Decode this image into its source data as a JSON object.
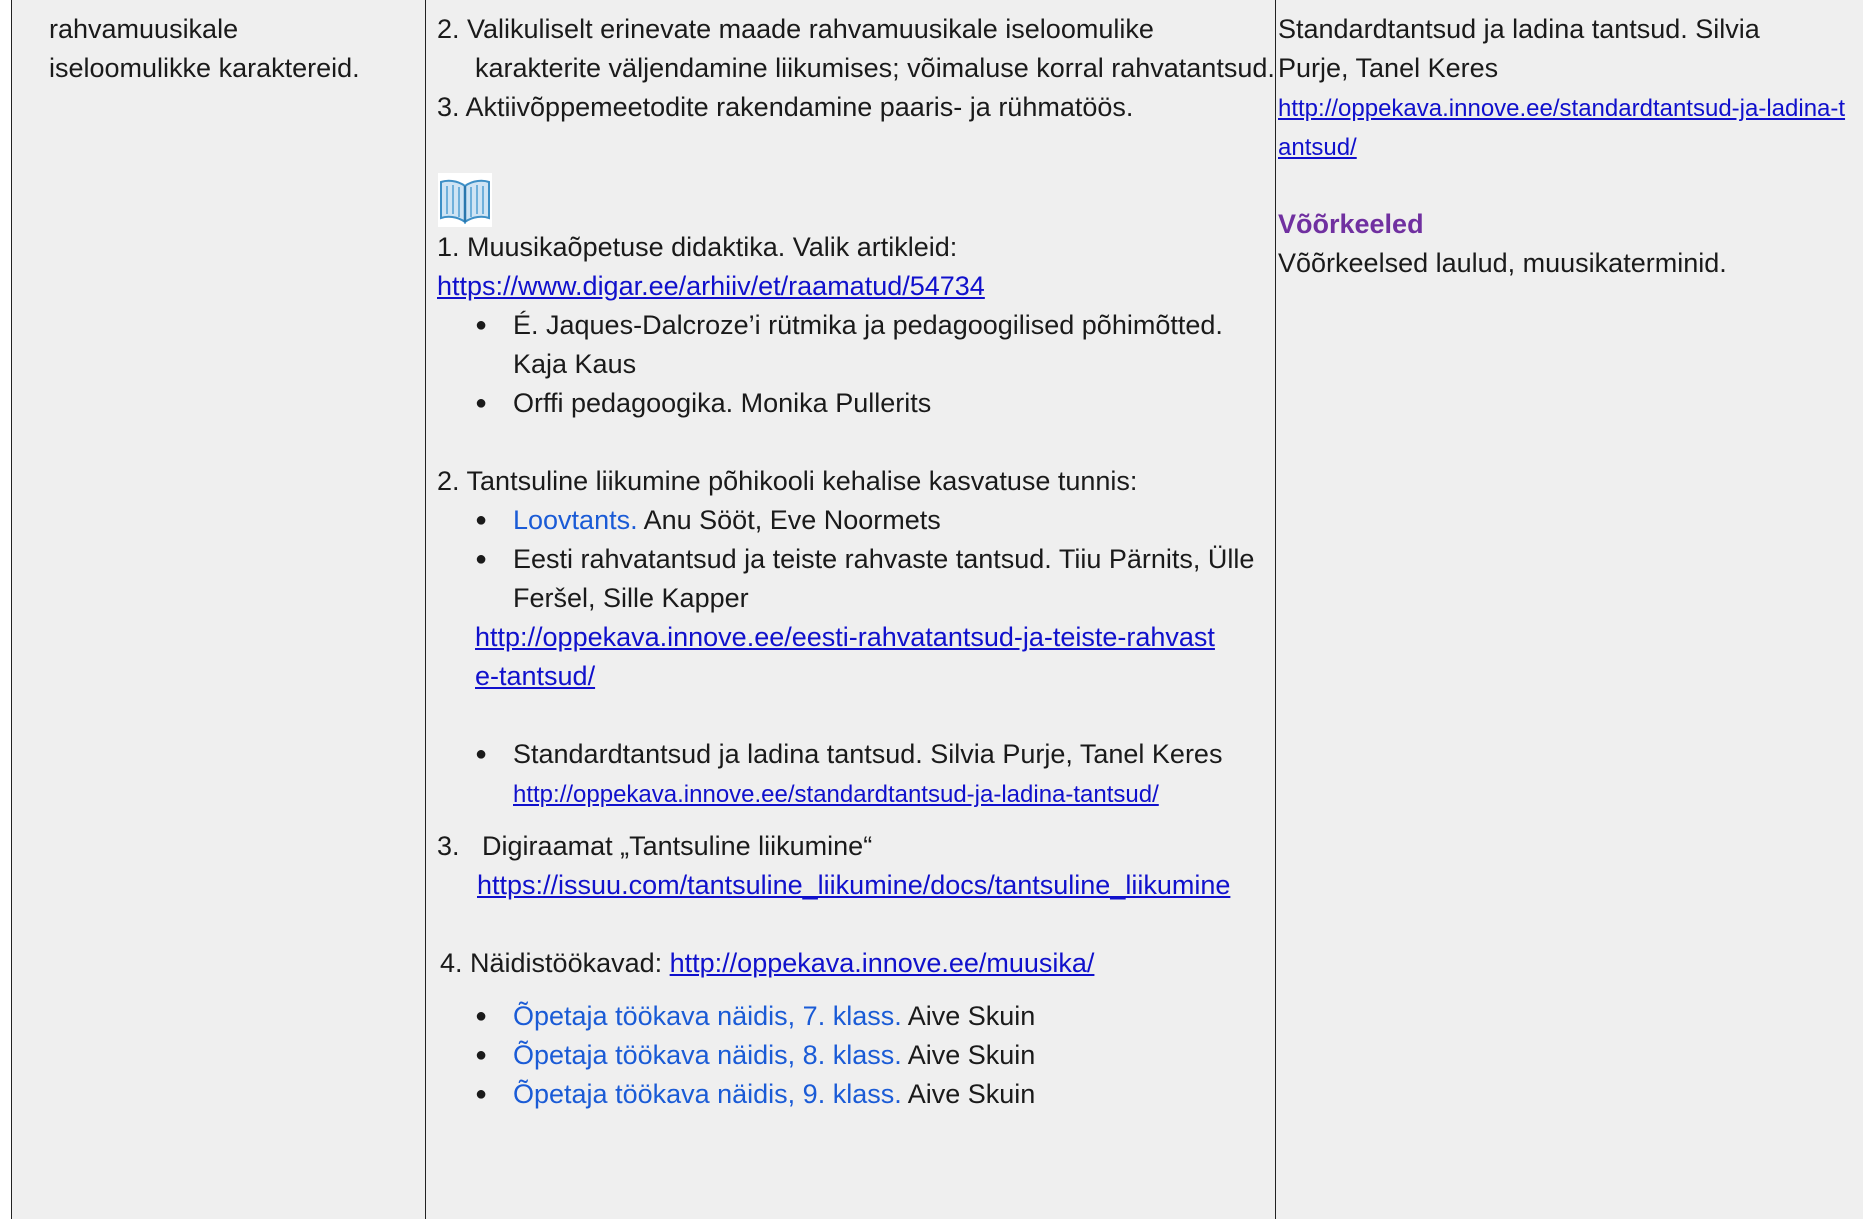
{
  "col1": {
    "lines": [
      "rahvamuusikale",
      "iseloomulikke karaktereid."
    ]
  },
  "col2": {
    "item2": "2. Valikuliselt erinevate maade rahvamuusikale iseloomulike karakterite väljendamine liikumises; võimaluse korral rahvatantsud.",
    "item3": "3. Aktiivõppemeetodite rakendamine paaris- ja rühmatöös.",
    "book_icon": "open-book-icon",
    "ref1": {
      "title": "1. Muusikaõpetuse didaktika. Valik artikleid:",
      "link": "https://www.digar.ee/arhiiv/et/raamatud/54734",
      "bullets": [
        "É. Jaques-Dalcroze’i rütmika ja pedagoogilised põhimõtted. Kaja Kaus",
        "Orffi pedagoogika. Monika Pullerits"
      ]
    },
    "ref2": {
      "title": "2. Tantsuline liikumine põhikooli kehalise kasvatuse tunnis:",
      "b1_link": "Loovtants.",
      "b1_rest": " Anu Sööt, Eve Noormets",
      "b2": "Eesti rahvatantsud ja teiste rahvaste tantsud. Tiiu Pärnits, Ülle Feršel, Sille Kapper",
      "b2_link": "http://oppekava.innove.ee/eesti-rahvatantsud-ja-teiste-rahvaste-tantsud/",
      "b3": "Standardtantsud ja ladina tantsud. Silvia Purje, Tanel Keres",
      "b3_link": "http://oppekava.innove.ee/standardtantsud-ja-ladina-tantsud/"
    },
    "ref3": {
      "number": "3.",
      "title": "Digiraamat „Tantsuline liikumine“",
      "link": "https://issuu.com/tantsuline_liikumine/docs/tantsuline_liikumine"
    },
    "ref4": {
      "label": "4. Näidistöökavad: ",
      "link": "http://oppekava.innove.ee/muusika/",
      "items": [
        {
          "link": "Õpetaja töökava näidis, 7. klass.",
          "author": " Aive Skuin"
        },
        {
          "link": "Õpetaja töökava näidis, 8. klass.",
          "author": " Aive Skuin"
        },
        {
          "link": "Õpetaja töökava näidis, 9. klass.",
          "author": " Aive Skuin"
        }
      ]
    }
  },
  "col3": {
    "text": "Standardtantsud ja ladina tantsud. Silvia Purje, Tanel Keres",
    "link": "http://oppekava.innove.ee/standardtantsud-ja-ladina-tantsud/",
    "heading": "Võõrkeeled",
    "body": "Võõrkeelsed laulud, muusikaterminid."
  }
}
